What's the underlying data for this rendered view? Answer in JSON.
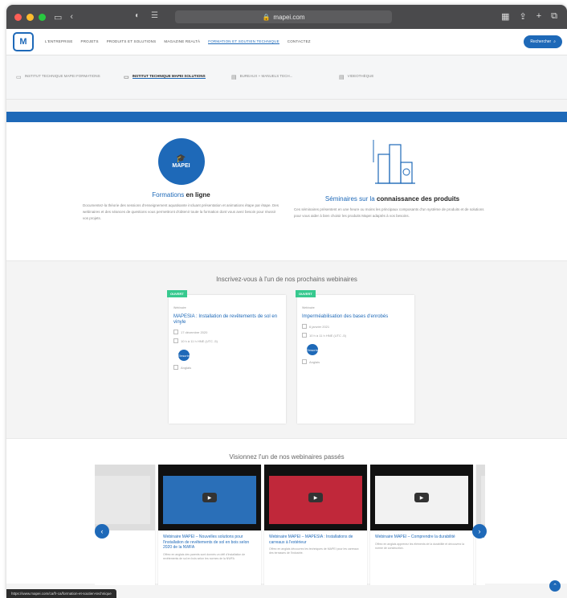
{
  "browser": {
    "url": "mapei.com",
    "lock_icon": "lock-icon"
  },
  "nav": {
    "items": [
      "L'ENTREPRISE",
      "PROJETS",
      "PRODUITS ET SOLUTIONS",
      "MAGAZINE REALTÀ",
      "FORMATION ET SOUTIEN TECHNIQUE",
      "CONTACTEZ"
    ],
    "active_index": 4,
    "search_label": "Rechercher"
  },
  "subnav": {
    "items": [
      {
        "label": "INSTITUT TECHNIQUE MAPEI FORMATIONS"
      },
      {
        "label": "INSTITUT TECHNIQUE MAPEI SOLUTIONS"
      },
      {
        "label": "BUREAUX + MANUELS TECH..."
      },
      {
        "label": "VIDEOTHÈQUE"
      }
    ],
    "active_index": 1
  },
  "features": [
    {
      "heading_pre": "Formations ",
      "heading_bold": "en ligne",
      "badge_text": "MAPEI",
      "desc": "Documentez-la théorie des sessions d'enseignement aquatisante incluant présentation et animations étape par étape. Des webinaires et des séances de questions vous permettront d'obtenir toute la formation dont vous avez besoin pour réussir vos projets."
    },
    {
      "heading_pre": "Séminaires sur la ",
      "heading_bold": "connaissance des produits",
      "desc": "Ces séminaires présentent en une heure ou moins les principaux composants d'un système de produits et de solutions pour vous aider à bien choisir les produits Mapei adaptés à vos besoins."
    }
  ],
  "upcoming": {
    "title": "Inscrivez-vous à l'un de nos prochains webinaires",
    "cards": [
      {
        "badge": "OUVERT",
        "type": "Webinaire",
        "title": "MAPESIA : Installation de revêtements de sol en vinyle",
        "date": "17 décembre 2020",
        "time": "10 h à 11 h HNE (UTC -5)",
        "register": "S'inscrire",
        "lang": "Anglais"
      },
      {
        "badge": "OUVERT",
        "type": "Webinaire",
        "title": "Imperméabilisation des bases d'enrobés",
        "date": "6 janvier 2021",
        "time": "10 h à 11 h HNE (UTC -5)",
        "register": "S'inscrire",
        "lang": "Anglais"
      }
    ]
  },
  "past": {
    "title": "Visionnez l'un de nos webinaires passés",
    "slides": [
      {
        "title": "…",
        "desc": "",
        "color": "#e8e8e8"
      },
      {
        "title": "Webinaire MAPEI – Nouvelles solutions pour l'installation de revêtements de sol en bois selon 2020 de la NWFA",
        "desc": "Offrez en anglais des parents sont donnés un défi d'installation de revêtements de sol en bois selon les normes de la NWFA",
        "color": "#2a6fb8"
      },
      {
        "title": "Webinaire MAPEI – MAPESIA : Installations de carreaux à l'extérieur",
        "desc": "Offrez en anglais découvrez les techniques de MAPEI pour les carreaux des terrasses de l'industrie.",
        "color": "#c0283a"
      },
      {
        "title": "Webinaire MAPEI – Comprendre la durabilité",
        "desc": "Offrez en anglais apprenez les éléments de la durabilité et découvrez la norme de construction.",
        "color": "#f2f2f2"
      },
      {
        "title": "Webi… Soluti… Plani…",
        "desc": "",
        "color": "#e8e8e8"
      }
    ]
  },
  "status_url": "https://www.mapei.com/ca/fr-ca/formation-et-soutien-technique",
  "colors": {
    "brand": "#1e69b8",
    "open": "#37c98f"
  }
}
